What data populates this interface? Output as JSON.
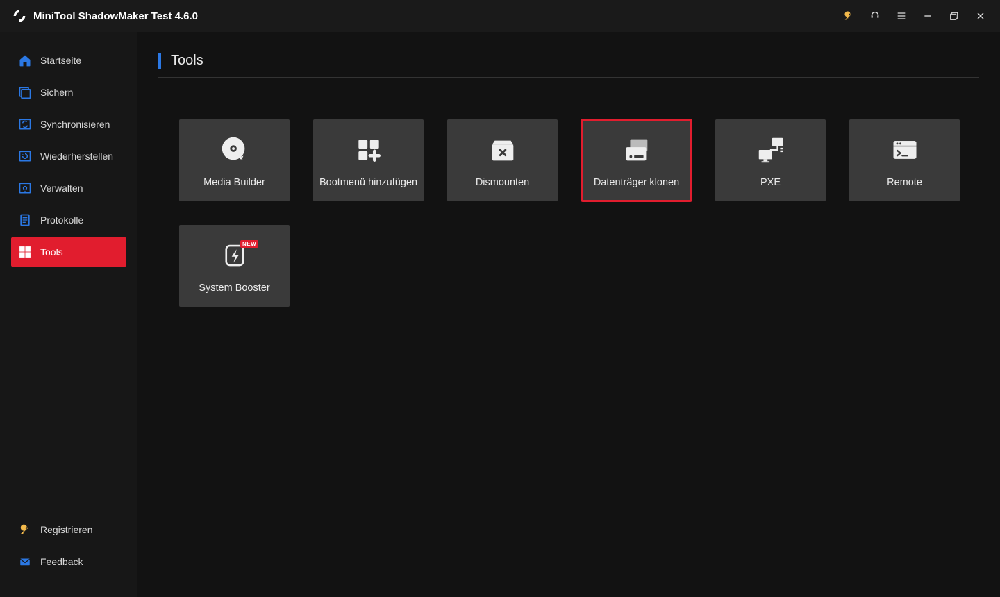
{
  "app": {
    "title": "MiniTool ShadowMaker Test 4.6.0"
  },
  "sidebar": {
    "items": [
      {
        "label": "Startseite"
      },
      {
        "label": "Sichern"
      },
      {
        "label": "Synchronisieren"
      },
      {
        "label": "Wiederherstellen"
      },
      {
        "label": "Verwalten"
      },
      {
        "label": "Protokolle"
      },
      {
        "label": "Tools"
      }
    ],
    "bottom": [
      {
        "label": "Registrieren"
      },
      {
        "label": "Feedback"
      }
    ]
  },
  "page": {
    "title": "Tools"
  },
  "tools": {
    "tiles": [
      {
        "label": "Media Builder"
      },
      {
        "label": "Bootmenü hinzufügen"
      },
      {
        "label": "Dismounten"
      },
      {
        "label": "Datenträger klonen"
      },
      {
        "label": "PXE"
      },
      {
        "label": "Remote"
      },
      {
        "label": "System Booster",
        "badge": "NEW"
      }
    ]
  }
}
